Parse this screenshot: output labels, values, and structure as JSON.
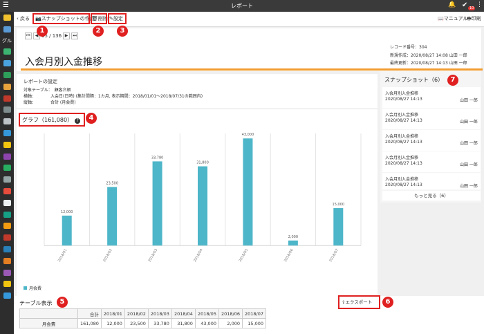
{
  "header": {
    "title": "レポート",
    "badge_count": "10"
  },
  "sidebar": {
    "label": "グル"
  },
  "toolbar": {
    "back_label": "戻る",
    "snapshot_label": "スナップショットの作成",
    "delete_label": "削除",
    "settings_label": "設定",
    "manual_label": "マニュアル",
    "print_label": "印刷"
  },
  "pager": {
    "position": "65 / 136"
  },
  "report": {
    "title": "入会月別入金推移",
    "record_no": "レコード番号：304",
    "created": "新規作成：2020/08/27 14:08 山田 一郎",
    "updated": "最終更新：2020/08/27 14:13 山田 一郎"
  },
  "settings": {
    "heading": "レポートの設定",
    "table": "対象テーブル：　顧客台帳",
    "x_axis": "横軸：　　　　入会日(日時) (集計間隔：1カ月, 表示期間：2018/01/01～2018/07/31の範囲内)",
    "y_axis": "縦軸：　　　　合計 (月会費)"
  },
  "graph": {
    "title": "グラフ（161,080）",
    "help": "?"
  },
  "chart_data": {
    "type": "bar",
    "categories": [
      "2018/01",
      "2018/02",
      "2018/03",
      "2018/04",
      "2018/05",
      "2018/06",
      "2018/07"
    ],
    "series": [
      {
        "name": "月会費",
        "values": [
          12000,
          23500,
          33780,
          31800,
          43000,
          2000,
          15000
        ]
      }
    ],
    "value_labels": [
      "12,000",
      "23,500",
      "33,780",
      "31,800",
      "43,000",
      "2,000",
      "15,000"
    ],
    "ylim": [
      0,
      45000
    ],
    "grid": true,
    "legend": "bottom-left",
    "color": "#4db6c9"
  },
  "snapshots": {
    "title": "スナップショット（6）",
    "items": [
      {
        "name": "入会月別入金推移",
        "date": "2020/08/27 14:13",
        "user": "山田 一郎"
      },
      {
        "name": "入会月別入金推移",
        "date": "2020/08/27 14:13",
        "user": "山田 一郎"
      },
      {
        "name": "入会月別入金推移",
        "date": "2020/08/27 14:13",
        "user": "山田 一郎"
      },
      {
        "name": "入会月別入金推移",
        "date": "2020/08/27 14:13",
        "user": "山田 一郎"
      },
      {
        "name": "入会月別入金推移",
        "date": "2020/08/27 14:13",
        "user": "山田 一郎"
      }
    ],
    "more": "もっと見る（6）"
  },
  "table_view": {
    "title": "テーブル表示",
    "export_label": "エクスポート",
    "headers": [
      "合計",
      "2018/01",
      "2018/02",
      "2018/03",
      "2018/04",
      "2018/05",
      "2018/06",
      "2018/07"
    ],
    "row_label": "月会費",
    "row": [
      "161,080",
      "12,000",
      "23,500",
      "33,780",
      "31,800",
      "43,000",
      "2,000",
      "15,000"
    ]
  },
  "callouts": [
    "1",
    "2",
    "3",
    "4",
    "5",
    "6",
    "7"
  ],
  "colors": {
    "accent": "#f29b2f",
    "callout": "#e02020",
    "bar": "#4db6c9"
  }
}
